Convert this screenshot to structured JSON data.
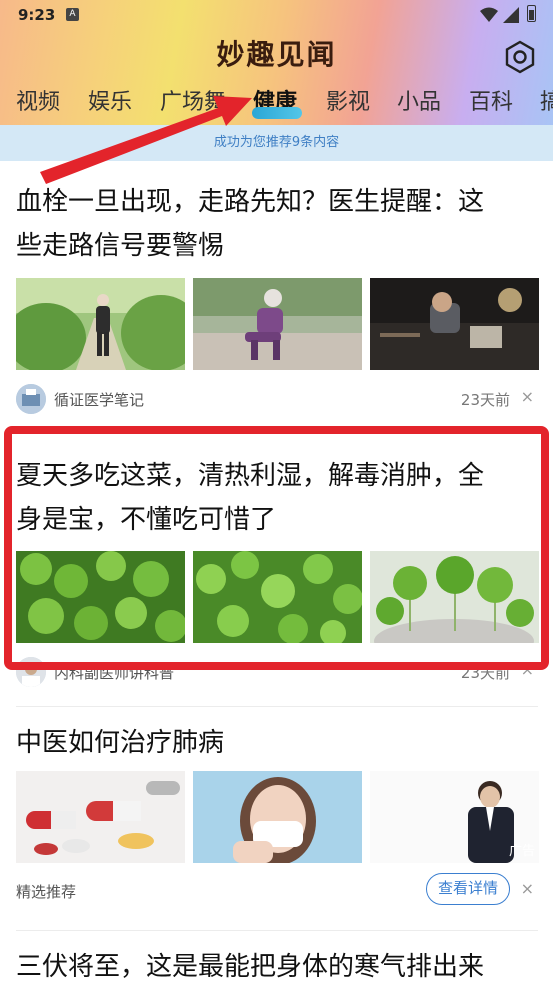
{
  "status_bar": {
    "time": "9:23",
    "notification": "A"
  },
  "app": {
    "title": "妙趣见闻"
  },
  "tabs": [
    {
      "label": "视频"
    },
    {
      "label": "娱乐"
    },
    {
      "label": "广场舞"
    },
    {
      "label": "健康",
      "active": true
    },
    {
      "label": "影视"
    },
    {
      "label": "小品"
    },
    {
      "label": "百科"
    },
    {
      "label": "搞"
    }
  ],
  "notice": "成功为您推荐9条内容",
  "articles": [
    {
      "title_line1": "血栓一旦出现，走路先知？医生提醒：这",
      "title_line2": "些走路信号要警惕",
      "images": [
        "elderly-man-walking",
        "elderly-woman-knee-pain",
        "man-at-desk-night"
      ],
      "source": "循证医学笔记",
      "time": "23天前",
      "close": "×"
    },
    {
      "title_line1": "夏天多吃这菜，清热利湿，解毒消肿，全",
      "title_line2": "身是宝，不懂吃可惜了",
      "images": [
        "pennywort-leaves-1",
        "pennywort-leaves-2",
        "pennywort-leaves-3"
      ],
      "source": "内科副医师讲科普",
      "time": "23天前",
      "close": "×"
    },
    {
      "title_line1": "中医如何治疗肺病",
      "images": [
        "pills-capsules",
        "woman-mask-cough",
        "man-coughing"
      ],
      "ad_tag": "广告",
      "source": "精选推荐",
      "detail_button": "查看详情",
      "close": "×"
    },
    {
      "title_line1": "三伏将至，这是最能把身体的寒气排出来"
    }
  ],
  "colors": {
    "highlight": "#e3242b",
    "accent": "#3b7fd0",
    "notice_bg": "#d4e8f6"
  }
}
